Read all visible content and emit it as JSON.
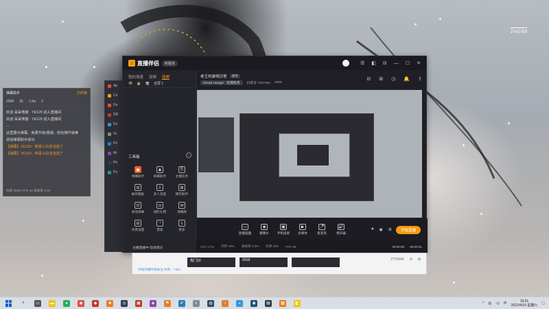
{
  "desktop": {
    "watermark": "ZHO/B8"
  },
  "danmu_panel": {
    "title": "弹幕助手",
    "status": "已封禁",
    "stats": [
      "2998",
      "35",
      "1.9w",
      "0"
    ],
    "messages": [
      {
        "text": "欢迎 呆呆熊猫 · YE129 进入直播间",
        "style": "normal"
      },
      {
        "text": "欢迎 呆呆熊猫 · YE129 进入直播间",
        "style": "normal"
      },
      {
        "text": "---",
        "style": "normal"
      },
      {
        "text": "这里展示弹幕、免费升级/感谢、粉丝牌升级等",
        "style": "normal"
      },
      {
        "text": "添加弹幕助手成功",
        "style": "normal"
      },
      {
        "text": "【弹幕】YE129：恭喜小白龙当选了",
        "style": "orange"
      },
      {
        "text": "【弹幕】YE129：恭喜小白龙当选了",
        "style": "orange"
      }
    ],
    "footer": "码率 0Kb/s  FPS 30  丢帧率 0.00"
  },
  "back_window": {
    "items": [
      "Ap",
      "Co",
      "De",
      "DR",
      "Do",
      "Gi",
      "Ph",
      "Mi",
      "Ph",
      "Po"
    ]
  },
  "main_window": {
    "app_name": "直播伴侣",
    "version_badge": "新版本",
    "window_controls": [
      "☰",
      "◧",
      "⊟",
      "—",
      "☐",
      "✕"
    ],
    "left_tabs": [
      "我的场景",
      "双屏",
      "竖屏"
    ],
    "active_left_tab": "竖屏",
    "scene_row": [
      "👁",
      "🔒",
      "🖥",
      "全屏 1"
    ],
    "tools_title": "工具箱",
    "tools": [
      {
        "label": "弹幕助手",
        "icon": "▣",
        "highlight": true
      },
      {
        "label": "屏幕助手",
        "icon": "♟",
        "highlight": false
      },
      {
        "label": "主播任务",
        "icon": "⎘",
        "highlight": false
      },
      {
        "label": "抽奖面板",
        "icon": "⊟",
        "highlight": false
      },
      {
        "label": "多人连麦",
        "icon": "⇩",
        "highlight": false
      },
      {
        "label": "精华助手",
        "icon": "⊞",
        "highlight": false
      },
      {
        "label": "滚动弹幕",
        "icon": "⊡",
        "highlight": false
      },
      {
        "label": "进阶礼物",
        "icon": "⊙",
        "highlight": false
      },
      {
        "label": "弹幕库",
        "icon": "✉",
        "highlight": false
      },
      {
        "label": "背景设置",
        "icon": "⊟",
        "highlight": false
      },
      {
        "label": "营收",
        "icon": "◔",
        "highlight": false
      },
      {
        "label": "更多",
        "icon": "⇩",
        "highlight": false
      }
    ],
    "room_title": "老王的游戏日常",
    "room_tag": "修改",
    "room_game": "Dread Hunger · 恐惧饥荒",
    "room_id": "抖音号 7297484",
    "room_fans": "2958",
    "header_icons": [
      "⊟",
      "⊞",
      "◷",
      "🔔",
      "⇪"
    ],
    "controls": [
      {
        "label": "直播画面",
        "icon": "▭"
      },
      {
        "label": "摄像头",
        "icon": "◉"
      },
      {
        "label": "手机投屏",
        "icon": "▣"
      },
      {
        "label": "多媒体",
        "icon": "▶"
      },
      {
        "label": "麦克风",
        "icon": "🎤"
      },
      {
        "label": "扬声器",
        "icon": "🔊"
      }
    ],
    "start_live_label": "开始直播",
    "status": [
      "CPU 17%",
      "内存 38%",
      "丢帧率 0.0%",
      "码率 0Kb",
      "FPS 30"
    ],
    "times": [
      "00:00:05",
      "00:00:01"
    ],
    "left_notice": "主播直播中 在线观众"
  },
  "browser_strip": {
    "thumb_labels": [
      "热门10",
      "2018"
    ],
    "footer_link": "开始开播时请关注 共有：7484",
    "right_buttons": [
      "2776449",
      "⊟",
      "⊞"
    ]
  },
  "taskbar": {
    "time": "19:51",
    "date": "2022/4/16 星期六",
    "lang": "中"
  }
}
